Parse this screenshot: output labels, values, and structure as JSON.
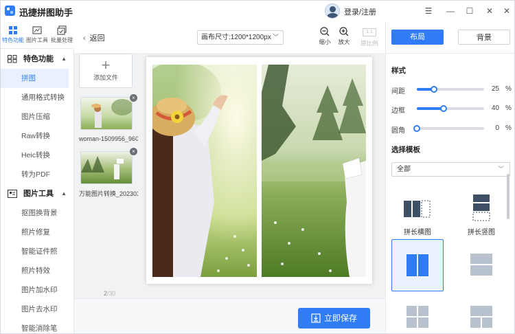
{
  "app": {
    "title": "迅捷拼图助手",
    "login_label": "登录/注册"
  },
  "window_controls": {
    "menu": "☰",
    "minimize": "—",
    "maximize": "☐",
    "close": "✕"
  },
  "toolbar": [
    {
      "label": "特色功能",
      "icon": "grid-icon",
      "active": true
    },
    {
      "label": "图片工具",
      "icon": "image-tool-icon",
      "active": false
    },
    {
      "label": "批量处理",
      "icon": "batch-icon",
      "active": false
    }
  ],
  "sidebar": {
    "groups": [
      {
        "title": "特色功能",
        "icon": "features-icon",
        "items": [
          "拼图",
          "通用格式转换",
          "图片压缩",
          "Raw转换",
          "Heic转换",
          "转为PDF"
        ]
      },
      {
        "title": "图片工具",
        "icon": "image-tools-icon",
        "items": [
          "抠图换背景",
          "照片修复",
          "智能证件照",
          "照片特效",
          "图片加水印",
          "图片去水印",
          "智能消除笔"
        ]
      }
    ],
    "active_item": "拼图"
  },
  "files": {
    "back_label": "返回",
    "add_label": "添加文件",
    "items": [
      {
        "name": "woman-1509956_960..."
      },
      {
        "name": "万能图片转换_202303..."
      }
    ],
    "pager_current": "2",
    "pager_total": "/30"
  },
  "canvas": {
    "size_label": "画布尺寸:1200*1200px",
    "zoom_out_label": "缩小",
    "zoom_in_label": "放大",
    "ratio_box": "1:1",
    "original_label": "原比例"
  },
  "save_label": "立即保存",
  "right_panel": {
    "tabs": {
      "layout": "布局",
      "background": "背景"
    },
    "style_title": "样式",
    "sliders": [
      {
        "label": "间距",
        "value": 25,
        "unit": "%"
      },
      {
        "label": "边框",
        "value": 40,
        "unit": "%"
      },
      {
        "label": "圆角",
        "value": 0,
        "unit": "%"
      }
    ],
    "template_title": "选择模板",
    "template_filter": "全部",
    "templates": [
      {
        "label": "拼长横图"
      },
      {
        "label": "拼长竖图"
      },
      {
        "label": ""
      },
      {
        "label": ""
      },
      {
        "label": ""
      },
      {
        "label": ""
      }
    ]
  },
  "colors": {
    "accent": "#2f7cf6",
    "active_bg": "#e8f1fd"
  }
}
